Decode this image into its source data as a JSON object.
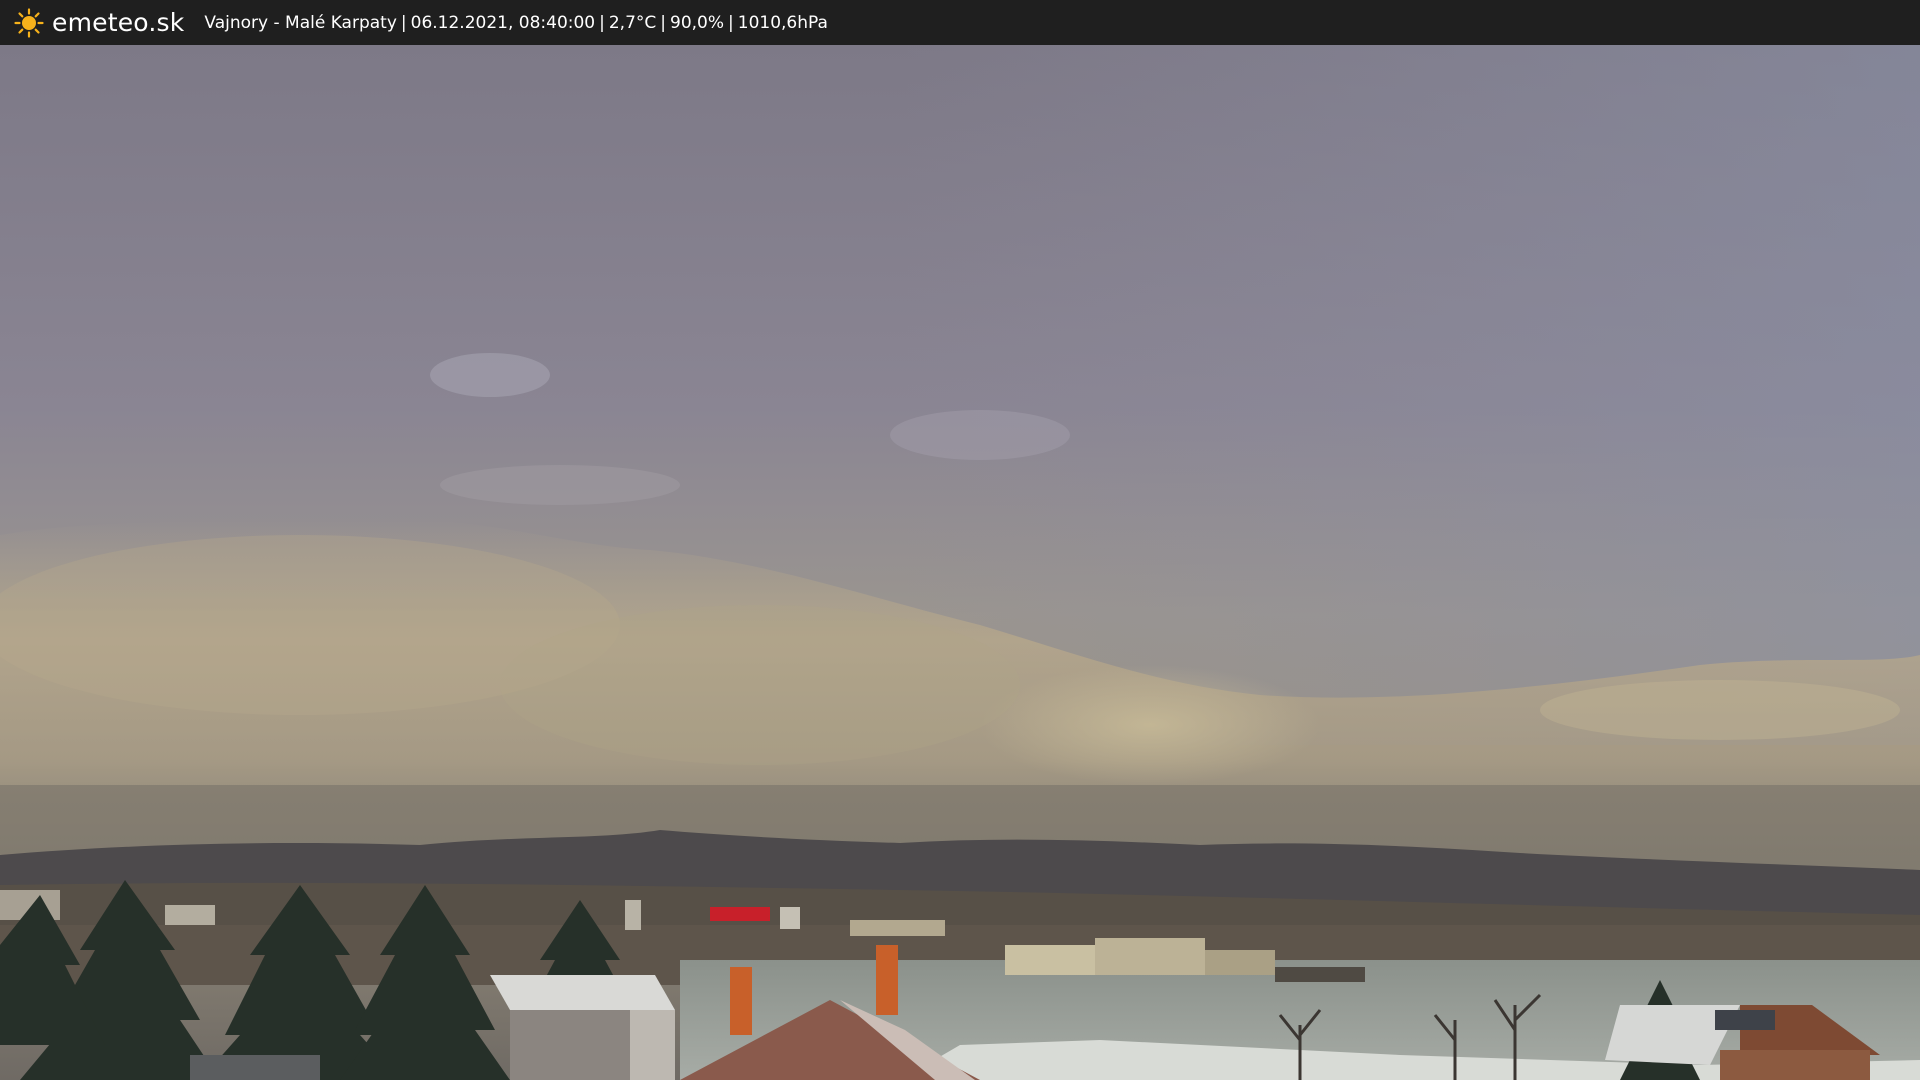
{
  "header": {
    "logo_icon": "sun-icon",
    "brand": "emeteo.sk",
    "location": "Vajnory - Malé Karpaty",
    "datetime": "06.12.2021, 08:40:00",
    "temperature": "2,7°C",
    "humidity": "90,0%",
    "pressure": "1010,6hPa",
    "separator": "|"
  },
  "colors": {
    "bar_background": "#1f1f1f",
    "text": "#ffffff",
    "sun": "#f7b21b"
  }
}
